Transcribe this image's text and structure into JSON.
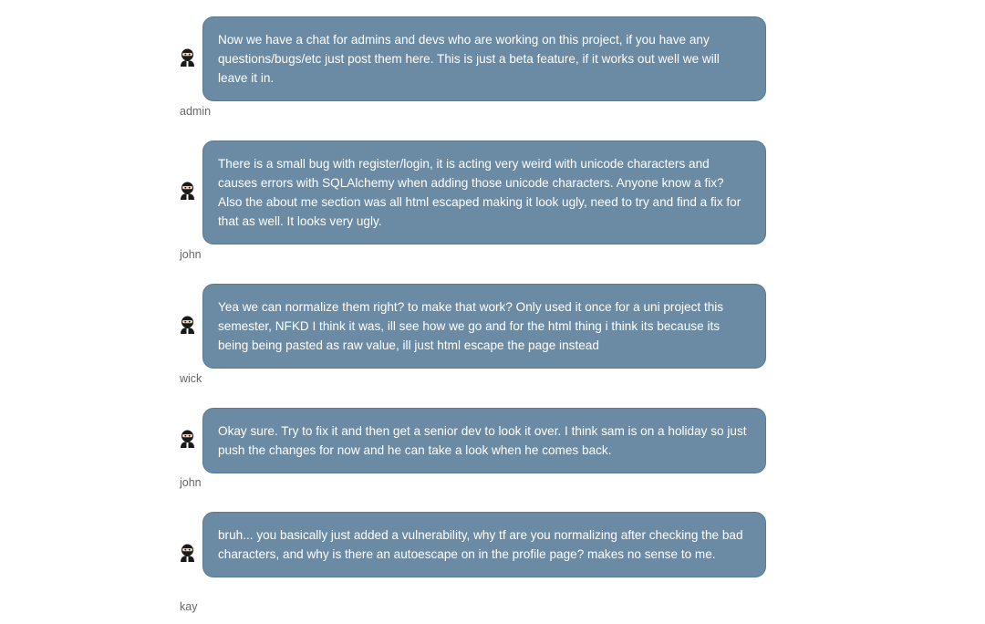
{
  "messages": [
    {
      "author": "admin",
      "avatar_icon": "ninja-avatar-icon",
      "text": "Now we have a chat for admins and devs who are working on this project, if you have any questions/bugs/etc just post them here. This is just a beta feature, if it works out well we will leave it in."
    },
    {
      "author": "john",
      "avatar_icon": "ninja-avatar-icon",
      "text": "There is a small bug with register/login, it is acting very weird with unicode characters and causes errors with SQLAlchemy when adding those unicode characters. Anyone know a fix? Also the about me section was all html escaped making it look ugly, need to try and find a fix for that as well. It looks very ugly."
    },
    {
      "author": "wick",
      "avatar_icon": "ninja-avatar-icon",
      "text": "Yea we can normalize them right? to make that work? Only used it once for a uni project this semester, NFKD I think it was, ill see how we go and for the html thing i think its because its being being pasted as raw value, ill just html escape the page instead"
    },
    {
      "author": "john",
      "avatar_icon": "ninja-avatar-icon",
      "text": "Okay sure. Try to fix it and then get a senior dev to look it over. I think sam is on a holiday so just push the changes for now and he can take a look when he comes back."
    },
    {
      "author": "kay",
      "avatar_icon": "ninja-avatar-icon",
      "text": "bruh... you basically just added a vulnerability, why tf are you normalizing after checking the bad characters, and why is there an autoescape on in the profile page? makes no sense to me."
    }
  ],
  "colors": {
    "bubble": "#6a8ba3",
    "bubble_border": "#5b7b92",
    "bubble_text": "#ffffff",
    "author_text": "#666666"
  }
}
